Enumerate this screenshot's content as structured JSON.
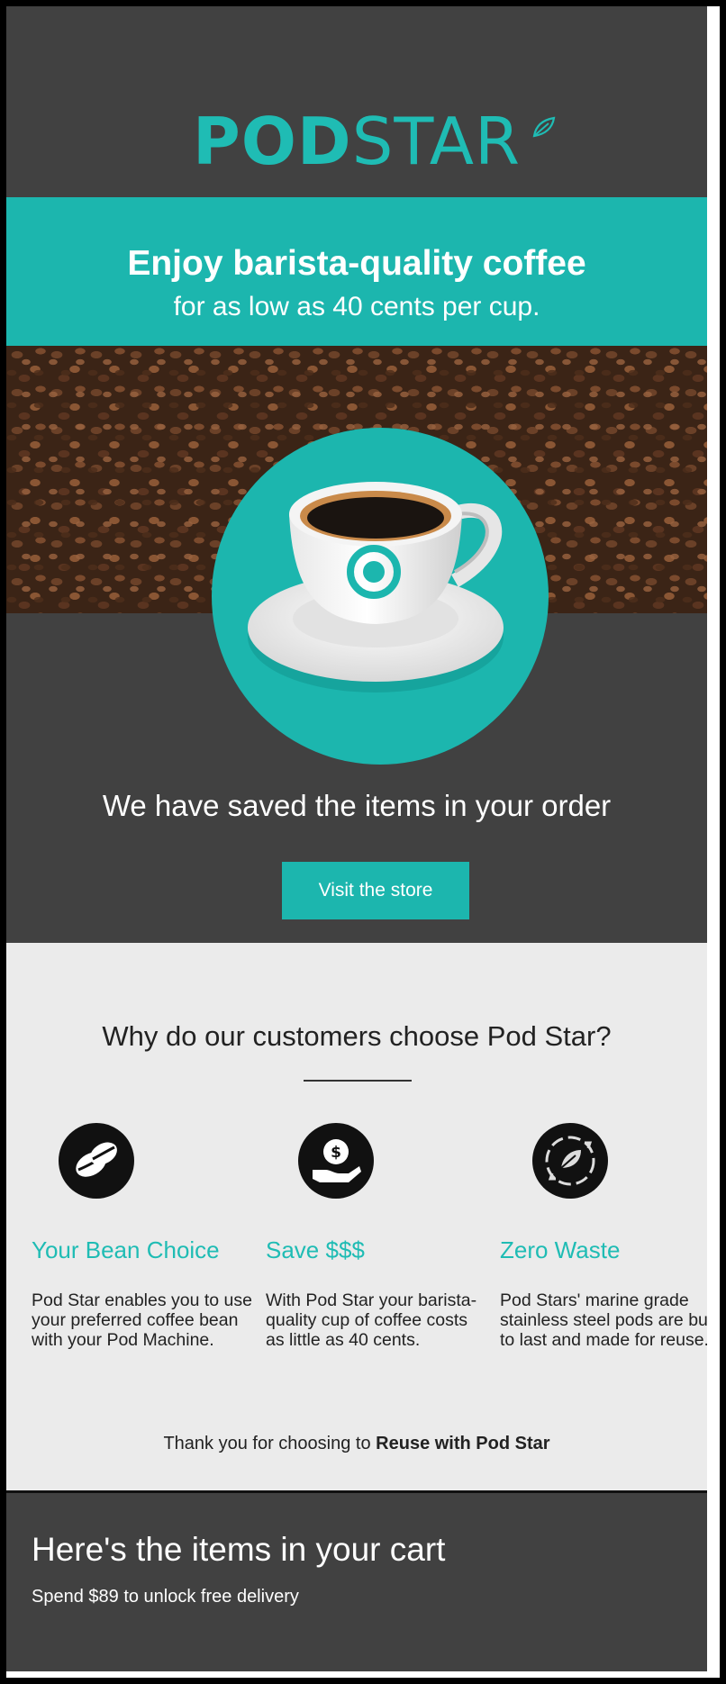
{
  "brand": {
    "logo_bold": "POD",
    "logo_light": "STAR",
    "accent": "#1cb6ae",
    "dark": "#414141"
  },
  "hero": {
    "title": "Enjoy barista-quality coffee",
    "subtitle": "for as low as 40 cents per cup."
  },
  "order": {
    "message": "We have saved the items in your order",
    "button_label": "Visit the store"
  },
  "why": {
    "title": "Why do our customers choose Pod Star?",
    "features": [
      {
        "icon": "coffee-bean-icon",
        "title": "Your Bean Choice",
        "body": "Pod Star enables you to use your preferred coffee bean with your Pod Machine."
      },
      {
        "icon": "hand-dollar-icon",
        "title": "Save $$$",
        "body": "With Pod Star your barista- quality cup of coffee costs as little as 40 cents."
      },
      {
        "icon": "recycle-leaf-icon",
        "title": "Zero Waste",
        "body": "Pod Stars' marine grade stainless steel pods are built to last and made for reuse."
      }
    ],
    "thanks_prefix": "Thank you for choosing to ",
    "thanks_bold": "Reuse with Pod Star"
  },
  "cart": {
    "title": "Here's the items in your cart",
    "subtitle": "Spend $89 to unlock free delivery"
  }
}
